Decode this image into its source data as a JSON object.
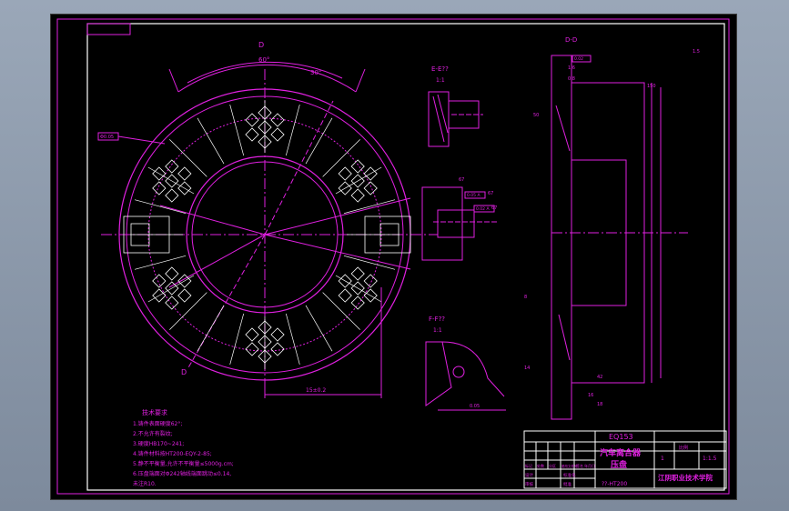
{
  "drawing": {
    "title_block": {
      "code": "EQ153",
      "name_line1": "汽车离合器",
      "name_line2": "压盘",
      "scale_header": "比例",
      "scale": "1:1.5",
      "quantity": "1",
      "school": "江阴职业技术学院",
      "material": "??-HT200",
      "row_labels": [
        "标记",
        "处数",
        "分区",
        "更改文件号",
        "签名",
        "年月日"
      ],
      "roles": [
        "设计",
        "审核",
        "工艺"
      ],
      "roles_right": [
        "标准化",
        "批准"
      ]
    },
    "tech_req": {
      "heading": "技术要求",
      "lines": [
        "1.铸件表面硬度62°;",
        "2.不允许有裂纹;",
        "3.硬度HB170~241;",
        "4.铸件材料按HT200-EQY-2-85;",
        "5.静不平衡量,允许不平衡量≤5000g.cm;",
        "6.压盘端面对Φ242轴线端面跳动≤0.14,",
        "  未注R10."
      ]
    },
    "section_labels": {
      "dd": "D-D",
      "ee": "E-E??",
      "ee_scale": "1:1",
      "ff": "F-F??",
      "ff_scale": "1:1",
      "d_mark": "D",
      "scale_note": "1.5"
    },
    "dims": [
      "15±0.2",
      "67",
      "30°",
      "60°",
      "0.05",
      "150",
      "1.6",
      "0.8",
      "50",
      "42",
      "8",
      "14",
      "16",
      "18",
      "1.6"
    ],
    "callouts": [
      "Φ0.05",
      "0.05 A",
      "0.02 A",
      "0.02"
    ]
  }
}
